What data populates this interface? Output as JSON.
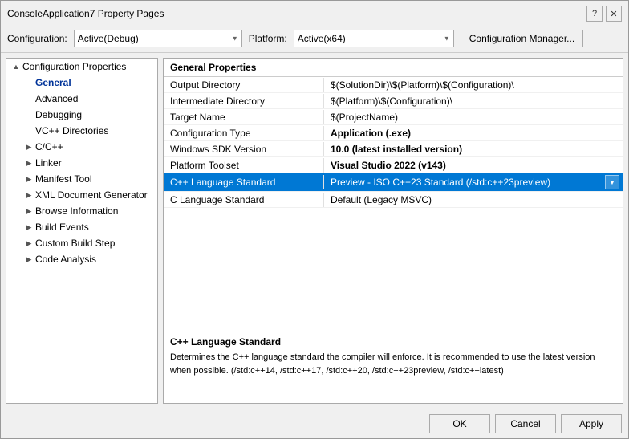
{
  "titleBar": {
    "title": "ConsoleApplication7 Property Pages",
    "helpBtn": "?",
    "closeBtn": "✕"
  },
  "configRow": {
    "configLabel": "Configuration:",
    "configValue": "Active(Debug)",
    "platformLabel": "Platform:",
    "platformValue": "Active(x64)",
    "configManagerBtn": "Configuration Manager..."
  },
  "leftPanel": {
    "treeItems": [
      {
        "id": "config-props",
        "label": "Configuration Properties",
        "indent": 0,
        "expanded": true,
        "expander": "▲",
        "selected": false
      },
      {
        "id": "general",
        "label": "General",
        "indent": 1,
        "expanded": false,
        "expander": "",
        "selected": false,
        "highlighted": true
      },
      {
        "id": "advanced",
        "label": "Advanced",
        "indent": 1,
        "expanded": false,
        "expander": "",
        "selected": false
      },
      {
        "id": "debugging",
        "label": "Debugging",
        "indent": 1,
        "expanded": false,
        "expander": "",
        "selected": false
      },
      {
        "id": "vc-dirs",
        "label": "VC++ Directories",
        "indent": 1,
        "expanded": false,
        "expander": "",
        "selected": false
      },
      {
        "id": "c-cpp",
        "label": "C/C++",
        "indent": 1,
        "expanded": false,
        "expander": "▶",
        "selected": false
      },
      {
        "id": "linker",
        "label": "Linker",
        "indent": 1,
        "expanded": false,
        "expander": "▶",
        "selected": false
      },
      {
        "id": "manifest-tool",
        "label": "Manifest Tool",
        "indent": 1,
        "expanded": false,
        "expander": "▶",
        "selected": false
      },
      {
        "id": "xml-doc-gen",
        "label": "XML Document Generator",
        "indent": 1,
        "expanded": false,
        "expander": "▶",
        "selected": false
      },
      {
        "id": "browse-info",
        "label": "Browse Information",
        "indent": 1,
        "expanded": false,
        "expander": "▶",
        "selected": false
      },
      {
        "id": "build-events",
        "label": "Build Events",
        "indent": 1,
        "expanded": false,
        "expander": "▶",
        "selected": false
      },
      {
        "id": "custom-build",
        "label": "Custom Build Step",
        "indent": 1,
        "expanded": false,
        "expander": "▶",
        "selected": false
      },
      {
        "id": "code-analysis",
        "label": "Code Analysis",
        "indent": 1,
        "expanded": false,
        "expander": "▶",
        "selected": false
      }
    ]
  },
  "rightPanel": {
    "header": "General Properties",
    "properties": [
      {
        "id": "output-dir",
        "name": "Output Directory",
        "value": "$(SolutionDir)\\$(Platform)\\$(Configuration)\\",
        "bold": false,
        "selected": false
      },
      {
        "id": "intermediate-dir",
        "name": "Intermediate Directory",
        "value": "$(Platform)\\$(Configuration)\\",
        "bold": false,
        "selected": false
      },
      {
        "id": "target-name",
        "name": "Target Name",
        "value": "$(ProjectName)",
        "bold": false,
        "selected": false
      },
      {
        "id": "config-type",
        "name": "Configuration Type",
        "value": "Application (.exe)",
        "bold": true,
        "selected": false
      },
      {
        "id": "win-sdk",
        "name": "Windows SDK Version",
        "value": "10.0 (latest installed version)",
        "bold": true,
        "selected": false
      },
      {
        "id": "platform-toolset",
        "name": "Platform Toolset",
        "value": "Visual Studio 2022 (v143)",
        "bold": true,
        "selected": false
      },
      {
        "id": "cpp-lang-std",
        "name": "C++ Language Standard",
        "value": "Preview - ISO C++23 Standard (/std:c++23preview)",
        "bold": false,
        "selected": true,
        "hasDropdown": true
      },
      {
        "id": "c-lang-std",
        "name": "C Language Standard",
        "value": "Default (Legacy MSVC)",
        "bold": false,
        "selected": false
      }
    ],
    "description": {
      "title": "C++ Language Standard",
      "text": "Determines the C++ language standard the compiler will enforce. It is recommended to use the latest version when possible.  (/std:c++14, /std:c++17, /std:c++20, /std:c++23preview, /std:c++latest)"
    }
  },
  "bottomBar": {
    "okLabel": "OK",
    "cancelLabel": "Cancel",
    "applyLabel": "Apply"
  }
}
